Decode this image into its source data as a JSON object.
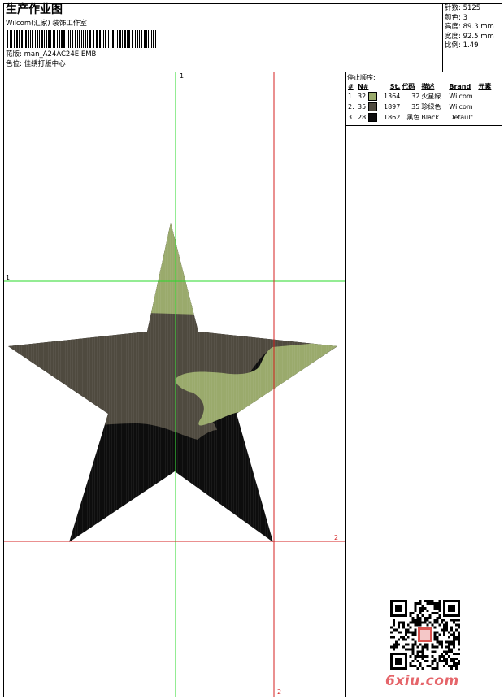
{
  "header": {
    "title": "生产作业图",
    "company": "Wilcom(汇家) 装饰工作室",
    "design_file_label": "花版:",
    "design_file": "man_A24AC24E.EMB",
    "color_owner_label": "色位:",
    "color_owner": "佳绣打版中心"
  },
  "stats": [
    {
      "label": "针数:",
      "value": "5125"
    },
    {
      "label": "颜色:",
      "value": "3"
    },
    {
      "label": "高度:",
      "value": "89.3 mm"
    },
    {
      "label": "宽度:",
      "value": "92.5 mm"
    },
    {
      "label": "比例:",
      "value": "1.49"
    }
  ],
  "legend": {
    "title": "停止顺序:",
    "columns": [
      "#",
      "N#",
      "St.",
      "代码",
      "描述",
      "Brand",
      "元素"
    ],
    "rows": [
      {
        "num": "1.",
        "n": "32",
        "color": "#9aaa6c",
        "st": "1364",
        "code": "32",
        "desc": "火星绿",
        "brand": "Wilcom"
      },
      {
        "num": "2.",
        "n": "35",
        "color": "#4f4a3f",
        "st": "1897",
        "code": "35",
        "desc": "珍绿色",
        "brand": "Wilcom"
      },
      {
        "num": "3.",
        "n": "28",
        "color": "#0d0d0d",
        "st": "1862",
        "code": "黑色",
        "desc": "Black",
        "brand": "Default"
      }
    ]
  },
  "guides": {
    "v_green": "1",
    "h_green": "1",
    "v_red": "2",
    "h_red": "2"
  },
  "colors": {
    "green_guide": "#2ad82a",
    "red_guide": "#d42222",
    "light_green": "#9aaa6c",
    "olive_dark": "#4f4a3f",
    "black": "#0d0d0d"
  },
  "watermark": {
    "brand": "6xiu.com"
  }
}
